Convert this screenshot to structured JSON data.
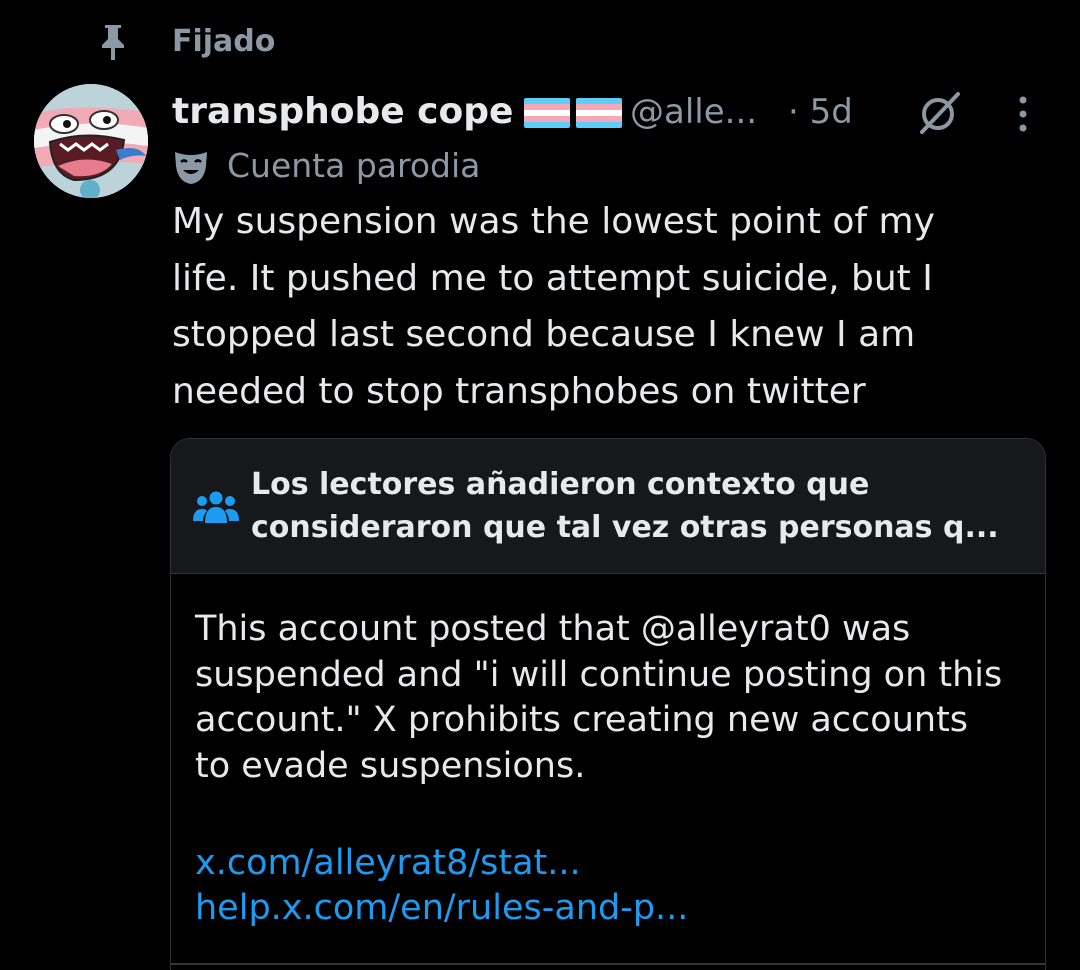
{
  "pinned": {
    "label": "Fijado",
    "icon": "pin-icon"
  },
  "author": {
    "display_name": "transphobe cope",
    "handle": "@alle...",
    "timestamp": "· 5d",
    "account_label": "Cuenta parodia",
    "icons": [
      "trans-flag-emoji",
      "trans-flag-emoji",
      "parody-mask-icon",
      "grok-icon",
      "more-options-icon"
    ]
  },
  "tweet": {
    "lines": [
      "My suspension was the lowest point of my",
      "life. It pushed me to attempt suicide, but I",
      "stopped last second because I knew I am",
      "needed to stop transphobes on twitter"
    ]
  },
  "community_note": {
    "title_lines": [
      "Los lectores añadieron contexto que",
      "consideraron que tal vez otras personas q..."
    ],
    "body_lines": [
      "This account posted that @alleyrat0 was",
      "suspended and \"i will continue posting on this",
      "account.\" X prohibits creating new accounts",
      "to evade suspensions."
    ],
    "links": [
      "x.com/alleyrat8/stat...",
      "help.x.com/en/rules-and-p..."
    ]
  },
  "colors": {
    "background": "#000000",
    "text_primary": "#e7e9ea",
    "text_secondary": "#8b98a5",
    "link": "#1d9bf0",
    "note_header_bg": "#16181c",
    "border": "#2f3336",
    "note_icon": "#1d9bf0"
  }
}
